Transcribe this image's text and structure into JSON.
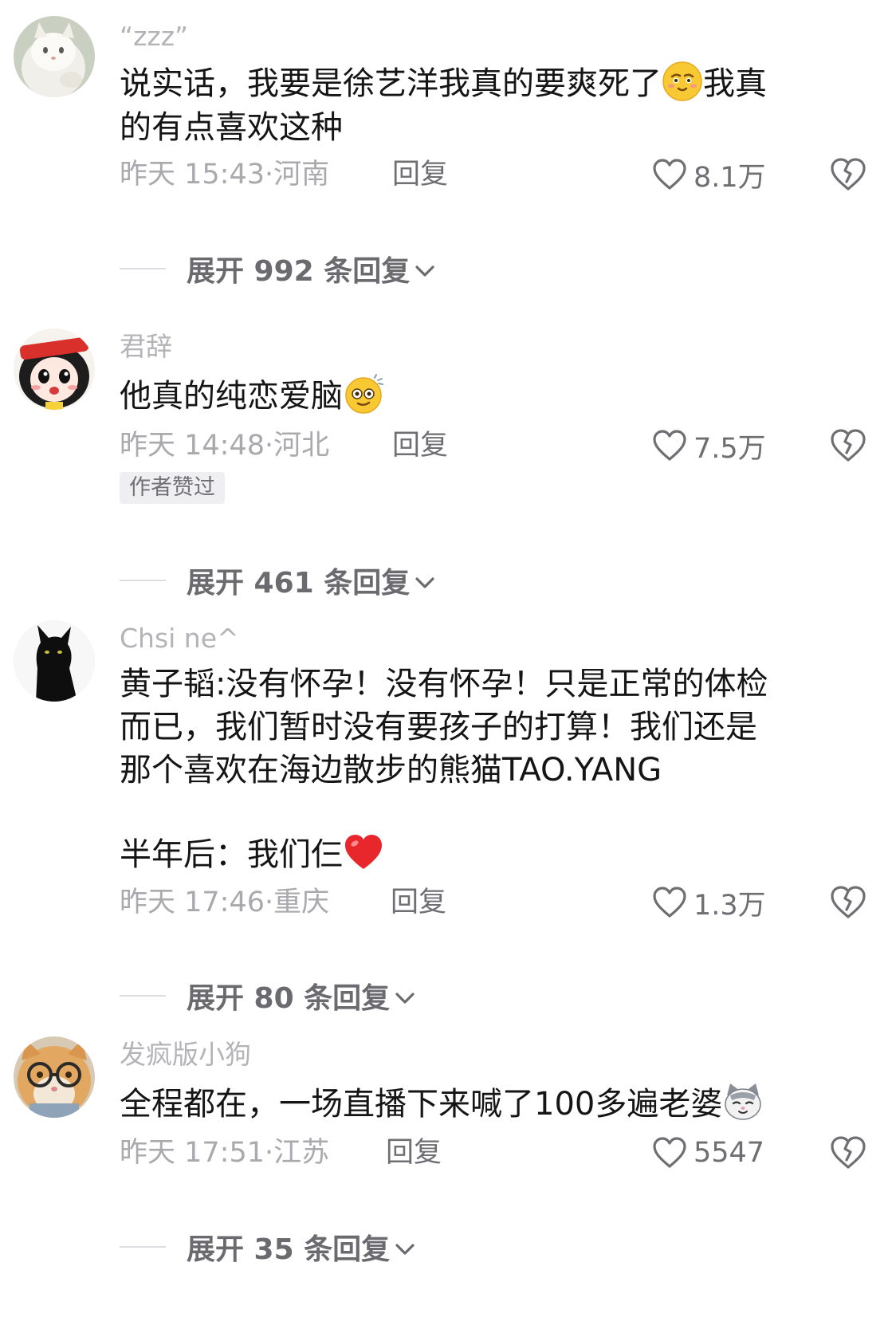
{
  "comments": [
    {
      "username": "“zzz”",
      "lines": [
        "说实话，我要是徐艺洋我真的要爽死了",
        "我真",
        "的有点喜欢这种"
      ],
      "emoji": "smirk-face-emoji",
      "time": "昨天 15:43",
      "location": "河南",
      "reply_label": "回复",
      "likes": "8.1万",
      "expand_label": "展开 992 条回复",
      "author_badge": ""
    },
    {
      "username": "君辞",
      "lines": [
        "他真的纯恋爱脑"
      ],
      "emoji": "dizzy-face-emoji",
      "time": "昨天 14:48",
      "location": "河北",
      "reply_label": "回复",
      "likes": "7.5万",
      "expand_label": "展开 461 条回复",
      "author_badge": "作者赞过"
    },
    {
      "username": "Chsi ne^",
      "lines": [
        "黄子韬:没有怀孕！没有怀孕！只是正常的体检",
        "而已，我们暂时没有要孩子的打算！我们还是",
        "那个喜欢在海边散步的熊猫TAO.YANG",
        "半年后：我们仨"
      ],
      "emoji": "red-heart-emoji",
      "time": "昨天 17:46",
      "location": "重庆",
      "reply_label": "回复",
      "likes": "1.3万",
      "expand_label": "展开 80 条回复",
      "author_badge": ""
    },
    {
      "username": "发疯版小狗",
      "lines": [
        "全程都在，一场直播下来喊了100多遍老婆"
      ],
      "emoji": "cat-face-emoji",
      "time": "昨天 17:51",
      "location": "江苏",
      "reply_label": "回复",
      "likes": "5547",
      "expand_label": "展开 35 条回复",
      "author_badge": ""
    }
  ],
  "separator": "·",
  "icons": {
    "like": "heart-outline-icon",
    "dislike": "broken-heart-icon",
    "expand": "chevron-down-icon"
  },
  "colors": {
    "username": "#b3b3b8",
    "meta": "#a9a9ae",
    "text": "#151515"
  }
}
